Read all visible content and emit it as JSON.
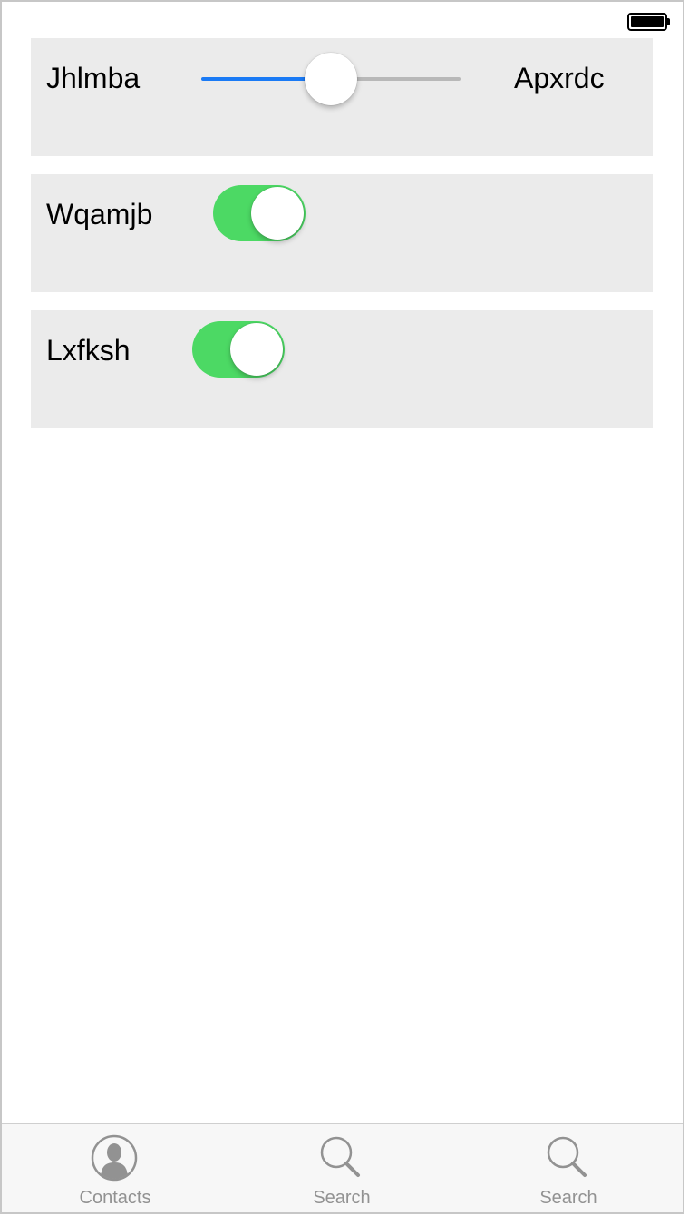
{
  "status_bar": {
    "battery_icon": "battery-full-icon"
  },
  "rows": {
    "slider_row": {
      "label": "Jhlmba",
      "value_label": "Apxrdc",
      "slider_value": 0.5,
      "accent_color": "#1a7af5"
    },
    "toggle_row_1": {
      "label": "Wqamjb",
      "on": true,
      "color": "#4cd964"
    },
    "toggle_row_2": {
      "label": "Lxfksh",
      "on": true,
      "color": "#4cd964"
    }
  },
  "tabbar": {
    "tabs": [
      {
        "label": "Contacts",
        "icon": "contacts-icon"
      },
      {
        "label": "Search",
        "icon": "search-icon"
      },
      {
        "label": "Search",
        "icon": "search-icon"
      }
    ]
  }
}
